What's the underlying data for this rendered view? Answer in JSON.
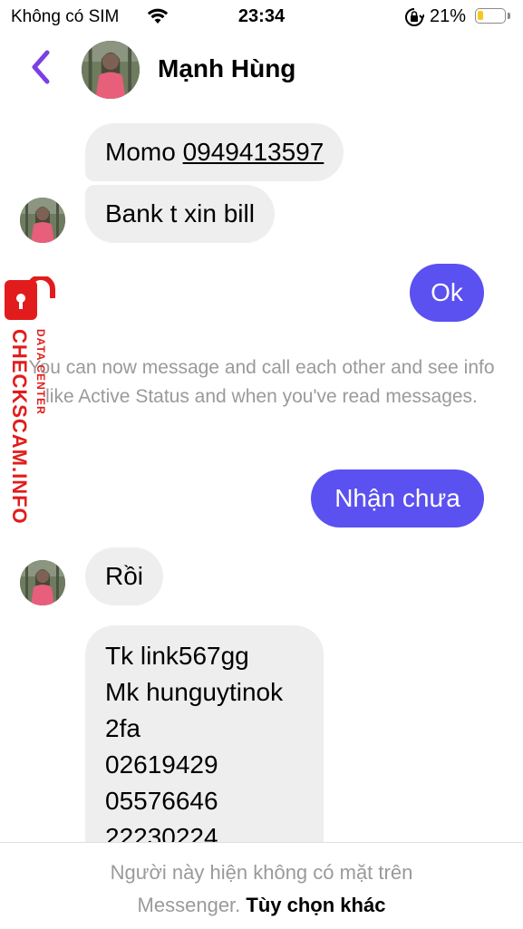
{
  "status_bar": {
    "carrier": "Không có SIM",
    "time": "23:34",
    "battery_percent": "21%",
    "battery_level": 0.21,
    "battery_color": "#f6c81f"
  },
  "header": {
    "back_icon": "chevron-left-icon",
    "contact_name": "Mạnh Hùng",
    "accent_color": "#7b3fe4"
  },
  "messages": [
    {
      "direction": "incoming",
      "prefix": "Momo ",
      "link": "0949413597"
    },
    {
      "direction": "incoming",
      "text": "Bank t xin bill"
    },
    {
      "direction": "outgoing",
      "text": "Ok"
    },
    {
      "direction": "system",
      "text": "You can now message and call each other and see info like Active Status and when you've read messages."
    },
    {
      "direction": "outgoing",
      "text": "Nhận chưa"
    },
    {
      "direction": "incoming",
      "text": "Rồi"
    },
    {
      "direction": "incoming",
      "lines": [
        "Tk link567gg",
        "Mk hunguytinok",
        "2fa",
        "02619429",
        "05576646",
        "22230224"
      ]
    }
  ],
  "colors": {
    "outgoing_bubble": "#5b50f0",
    "incoming_bubble": "#eeeeef"
  },
  "footer": {
    "notice": "Người này hiện không có mặt trên",
    "notice_2": "Messenger.",
    "more_options": "Tùy chọn khác"
  },
  "watermark": {
    "brand": "CHECKSCAM.INFO",
    "sub": "DATA CENTER",
    "icon": "padlock-icon",
    "color": "#e21c1c"
  }
}
